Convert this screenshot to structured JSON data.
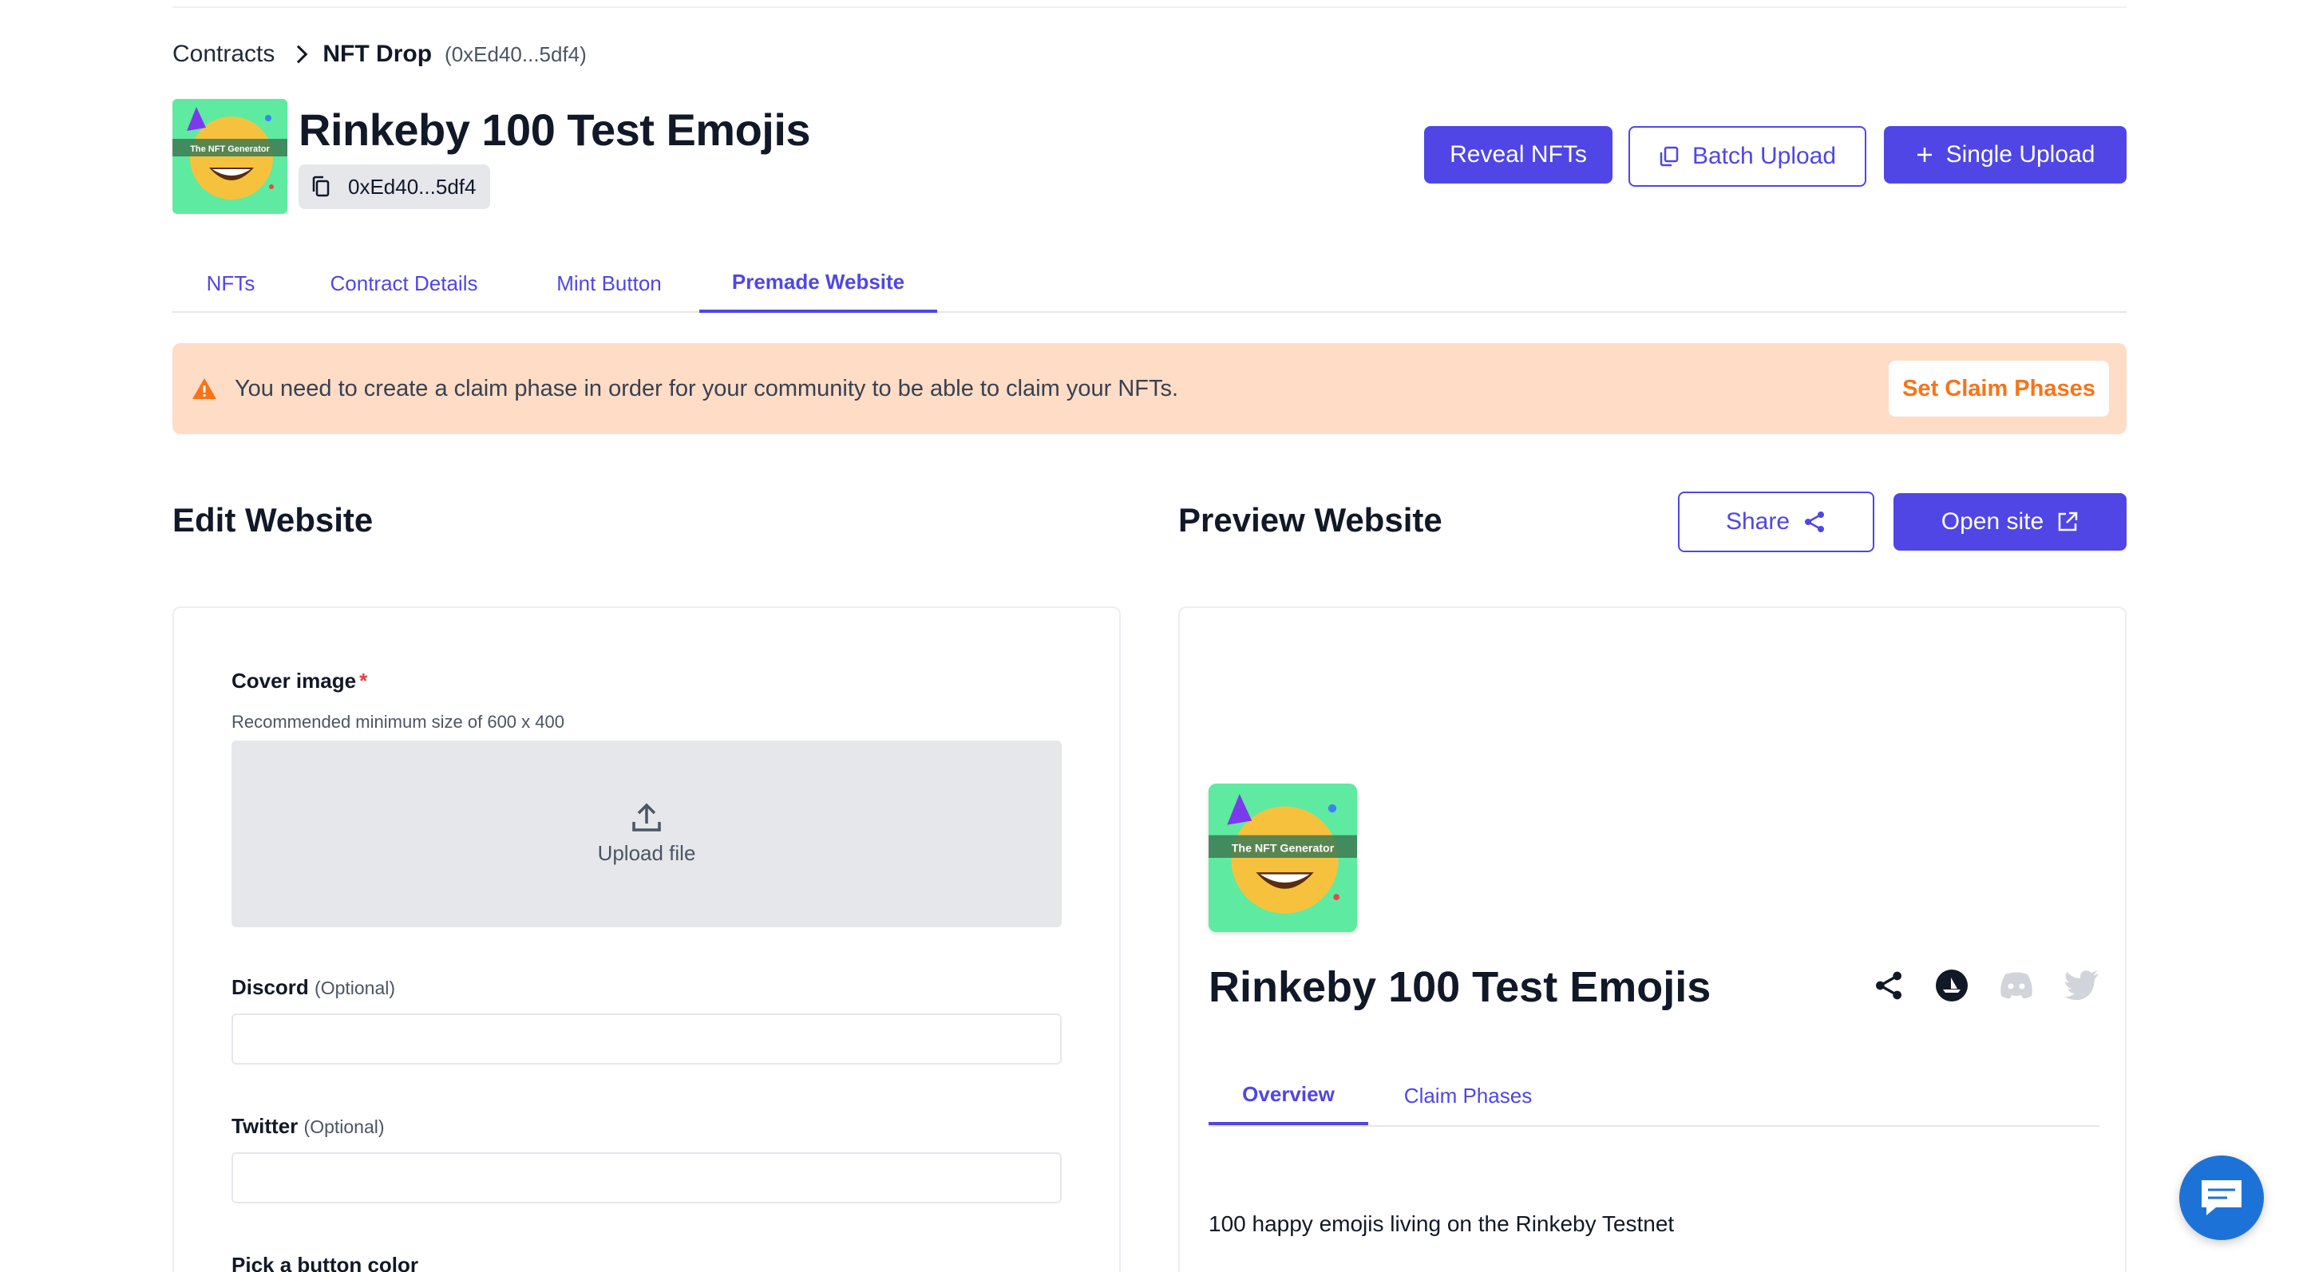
{
  "breadcrumb": {
    "root": "Contracts",
    "current": "NFT Drop",
    "address": "(0xEd40...5df4)"
  },
  "header": {
    "title": "Rinkeby 100 Test Emojis",
    "address": "0xEd40...5df4",
    "thumb_caption": "The NFT Generator",
    "buttons": {
      "reveal": "Reveal NFTs",
      "batch": "Batch Upload",
      "single": "Single Upload"
    }
  },
  "tabs": [
    "NFTs",
    "Contract Details",
    "Mint Button",
    "Premade Website"
  ],
  "alert": {
    "text": "You need to create a claim phase in order for your community to be able to claim your NFTs.",
    "button": "Set Claim Phases"
  },
  "edit": {
    "title": "Edit Website",
    "cover_label": "Cover image",
    "cover_required": "*",
    "cover_hint": "Recommended minimum size of 600 x 400",
    "upload_text": "Upload file",
    "discord_label": "Discord",
    "twitter_label": "Twitter",
    "optional": "(Optional)",
    "color_label": "Pick a button color"
  },
  "preview": {
    "title": "Preview Website",
    "share": "Share",
    "open": "Open site",
    "name": "Rinkeby 100 Test Emojis",
    "tabs": [
      "Overview",
      "Claim Phases"
    ],
    "description": "100 happy emojis living on the Rinkeby Testnet"
  },
  "colors": {
    "accent": "#4f46e5",
    "alert_bg": "#fedcc6",
    "alert_btn": "#f97316",
    "chat": "#1d72d8"
  },
  "icons": [
    "chevron-right-icon",
    "copy-icon",
    "plus-icon",
    "warning-icon",
    "share-icon",
    "external-link-icon",
    "upload-icon",
    "opensea-icon",
    "discord-icon",
    "twitter-icon",
    "chat-icon"
  ]
}
